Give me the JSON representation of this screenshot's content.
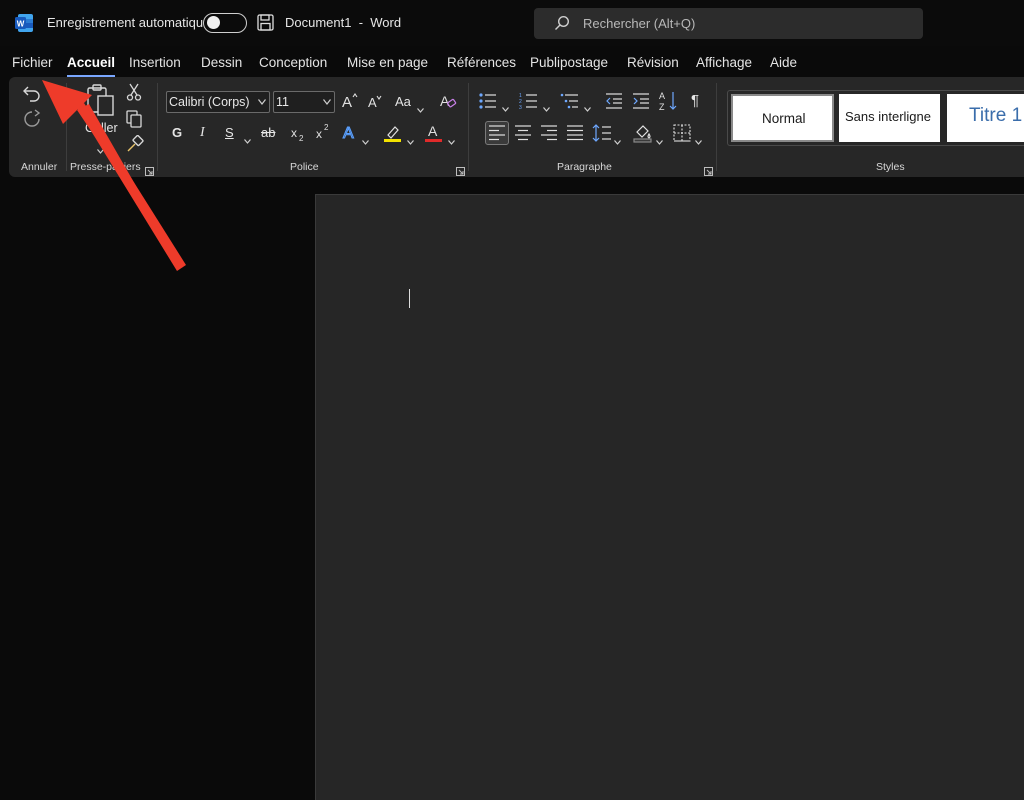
{
  "titlebar": {
    "autosave_label": "Enregistrement automatique",
    "doc_title": "Document1  -  Word",
    "search_placeholder": "Rechercher (Alt+Q)",
    "icons": [
      "word-logo",
      "toggle-switch",
      "save-icon",
      "search-icon"
    ]
  },
  "tabs": [
    {
      "label": "Fichier"
    },
    {
      "label": "Accueil"
    },
    {
      "label": "Insertion"
    },
    {
      "label": "Dessin"
    },
    {
      "label": "Conception"
    },
    {
      "label": "Mise en page"
    },
    {
      "label": "Références"
    },
    {
      "label": "Publipostage"
    },
    {
      "label": "Révision"
    },
    {
      "label": "Affichage"
    },
    {
      "label": "Aide"
    }
  ],
  "ribbon": {
    "groups": {
      "annuler": "Annuler",
      "presse": "Presse-papiers",
      "police": "Police",
      "paragraphe": "Paragraphe",
      "styles": "Styles"
    },
    "paste_label": "Coller",
    "font_name": "Calibri (Corps)",
    "font_size": "11",
    "case_label": "Aa",
    "bold": "G",
    "italic": "I",
    "underline": "S",
    "strike": "ab",
    "styles": [
      {
        "label": "Normal"
      },
      {
        "label": "Sans interligne"
      },
      {
        "label": "Titre 1"
      }
    ]
  },
  "colors": {
    "accent_tab_underline": "#7aa7ff",
    "highlight_yellow": "#f3e200",
    "font_red": "#e02a2a",
    "annotation_arrow": "#ee3b2a",
    "title_style_blue": "#3a6dab"
  }
}
